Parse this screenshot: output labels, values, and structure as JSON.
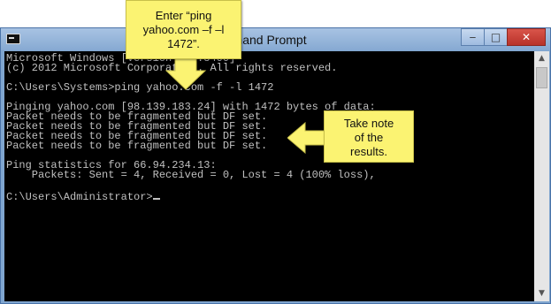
{
  "window": {
    "title": "Command Prompt",
    "min_symbol": "‒",
    "max_symbol": "□",
    "close_symbol": "✕"
  },
  "console": {
    "lines": [
      "Microsoft Windows [Version 6.2.8400]",
      "(c) 2012 Microsoft Corporation. All rights reserved.",
      "",
      "C:\\Users\\Systems>ping yahoo.com -f -l 1472",
      "",
      "Pinging yahoo.com [98.139.183.24] with 1472 bytes of data:",
      "Packet needs to be fragmented but DF set.",
      "Packet needs to be fragmented but DF set.",
      "Packet needs to be fragmented but DF set.",
      "Packet needs to be fragmented but DF set.",
      "",
      "Ping statistics for 66.94.234.13:",
      "    Packets: Sent = 4, Received = 0, Lost = 4 (100% loss),",
      "",
      "C:\\Users\\Administrator>"
    ]
  },
  "callouts": {
    "top": [
      "Enter “ping",
      "yahoo.com –f –l",
      "1472”."
    ],
    "right": [
      "Take note",
      "of the",
      "results."
    ]
  },
  "colors": {
    "console_bg": "#000000",
    "console_text": "#c0c0c0",
    "callout_bg": "#fbf372",
    "frame": "#7fa5cf"
  },
  "icons": {
    "app": "console-icon",
    "arrow": "yellow-arrow-icon"
  }
}
